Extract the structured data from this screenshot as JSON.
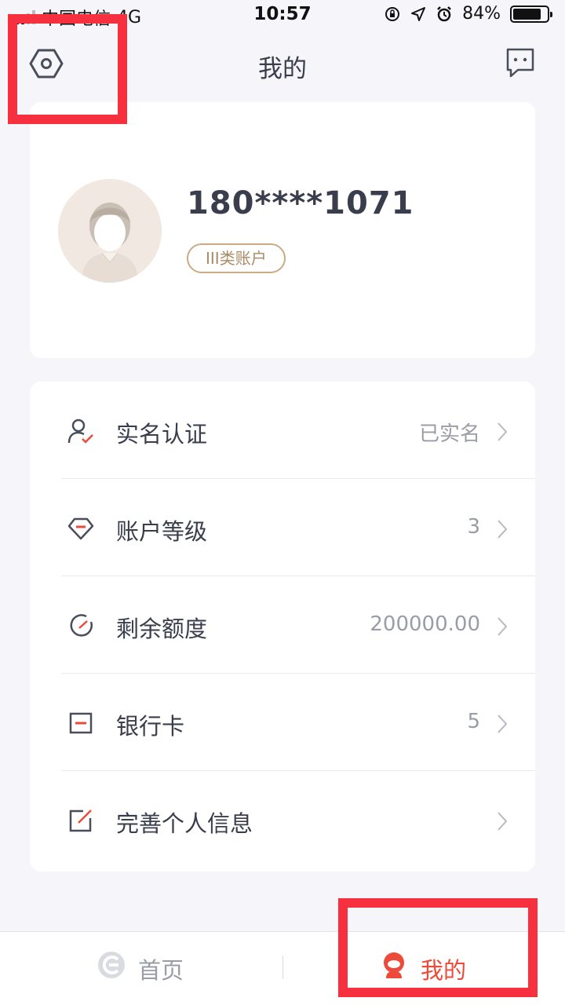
{
  "status_bar": {
    "carrier": "中国电信",
    "network": "4G",
    "time": "10:57",
    "battery_percent_text": "84%",
    "battery_level": 0.84
  },
  "nav": {
    "title": "我的",
    "settings_icon": "hexagon-settings-icon",
    "message_icon": "chat-bubble-icon"
  },
  "profile": {
    "phone": "180****1071",
    "account_type": "III类账户",
    "avatar_icon": "user-avatar-icon"
  },
  "menu": {
    "items": [
      {
        "label": "实名认证",
        "value": "已实名",
        "icon": "user-check-icon"
      },
      {
        "label": "账户等级",
        "value": "3",
        "icon": "diamond-level-icon"
      },
      {
        "label": "剩余额度",
        "value": "200000.00",
        "icon": "gauge-icon"
      },
      {
        "label": "银行卡",
        "value": "5",
        "icon": "bank-card-icon"
      },
      {
        "label": "完善个人信息",
        "value": "",
        "icon": "edit-icon"
      }
    ]
  },
  "tab_bar": {
    "home_label": "首页",
    "mine_label": "我的"
  },
  "colors": {
    "accent": "#ec4a3a",
    "highlight": "#f7303f",
    "text_primary": "#3a3d4c",
    "text_secondary": "#9a9ca6",
    "badge": "#c9ab86",
    "background": "#f6f6fa"
  }
}
